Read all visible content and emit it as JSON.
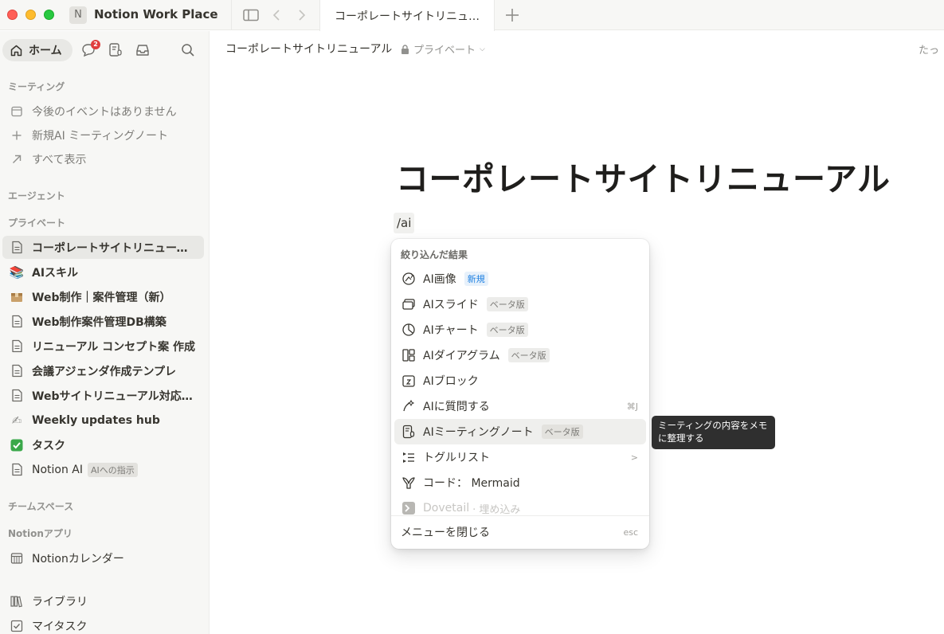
{
  "window": {
    "workspace_initial": "N",
    "workspace_name": "Notion Work Place"
  },
  "tabs": [
    {
      "label": "コーポレートサイトリニューアル"
    }
  ],
  "sidebar": {
    "home_label": "ホーム",
    "inbox_badge": "2",
    "sections": {
      "meetings": "ミーティング",
      "agents": "エージェント",
      "private": "プライベート",
      "teamspaces": "チームスペース",
      "apps": "Notionアプリ"
    },
    "meeting_items": [
      {
        "label": "今後のイベントはありません",
        "icon": "calendar-icon"
      },
      {
        "label": "新規AI ミーティングノート",
        "icon": "plus-icon"
      },
      {
        "label": "すべて表示",
        "icon": "arrow-up-right-icon"
      }
    ],
    "private_items": [
      {
        "label": "コーポレートサイトリニューアル",
        "icon": "page-icon"
      },
      {
        "label": "AIスキル",
        "icon": "books-emoji"
      },
      {
        "label": "Web制作｜案件管理（新）",
        "icon": "box-emoji"
      },
      {
        "label": "Web制作案件管理DB構築",
        "icon": "page-icon"
      },
      {
        "label": "リニューアル コンセプト案 作成",
        "icon": "page-icon"
      },
      {
        "label": "会議アジェンダ作成テンプレ",
        "icon": "page-icon"
      },
      {
        "label": "Webサイトリニューアル対応の…",
        "icon": "page-icon"
      },
      {
        "label": "Weekly updates hub",
        "icon": "writing-hand-emoji"
      },
      {
        "label": "タスク",
        "icon": "check-mark-emoji"
      },
      {
        "label": "Notion AI",
        "icon": "page-icon",
        "chip": "AIへの指示"
      }
    ],
    "app_items": [
      {
        "label": "Notionカレンダー",
        "icon": "calendar-grid-icon"
      }
    ],
    "bottom_items": [
      {
        "label": "ライブラリ",
        "icon": "library-icon"
      },
      {
        "label": "マイタスク",
        "icon": "checkbox-icon"
      }
    ]
  },
  "topbar": {
    "breadcrumb": "コーポレートサイトリニューアル",
    "privacy": "プライベート",
    "right_text": "たっ"
  },
  "page": {
    "title": "コーポレートサイトリニューアル",
    "command_text": "/ai"
  },
  "slash_menu": {
    "header": "絞り込んだ結果",
    "items": [
      {
        "label": "AI画像",
        "tag": "新規",
        "tag_type": "new",
        "icon": "ai-image-icon"
      },
      {
        "label": "AIスライド",
        "tag": "ベータ版",
        "tag_type": "beta",
        "icon": "slides-icon"
      },
      {
        "label": "AIチャート",
        "tag": "ベータ版",
        "tag_type": "beta",
        "icon": "pie-chart-icon"
      },
      {
        "label": "AIダイアグラム",
        "tag": "ベータ版",
        "tag_type": "beta",
        "icon": "diagram-icon"
      },
      {
        "label": "AIブロック",
        "icon": "ai-block-icon"
      },
      {
        "label": "AIに質問する",
        "shortcut": "⌘J",
        "icon": "ai-ask-icon"
      },
      {
        "label": "AIミーティングノート",
        "tag": "ベータ版",
        "tag_type": "beta",
        "icon": "meeting-note-icon",
        "hover": true
      },
      {
        "label": "トグルリスト",
        "shortcut": ">",
        "icon": "toggle-list-icon"
      },
      {
        "label": "コード： Mermaid",
        "icon": "mermaid-icon"
      },
      {
        "label": "Dovetail",
        "sub": "· 埋め込み",
        "icon": "dovetail-icon",
        "faded": true
      }
    ],
    "close_label": "メニューを閉じる",
    "close_shortcut": "esc"
  },
  "tooltip": {
    "text": "ミーティングの内容をメモに整理する"
  }
}
